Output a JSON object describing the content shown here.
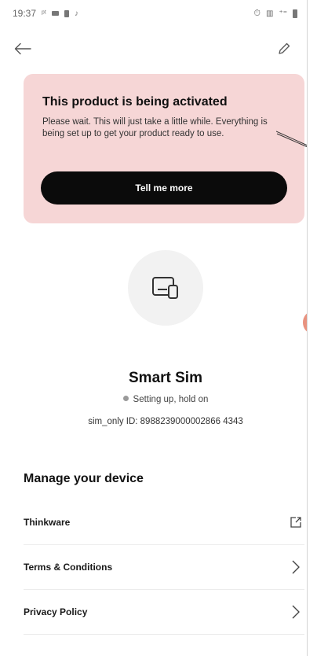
{
  "status_bar": {
    "time": "19:37"
  },
  "banner": {
    "title": "This product is being activated",
    "body": "Please wait. This will just take a little while. Everything is being set up to get your product ready to use.",
    "button_label": "Tell me more"
  },
  "device": {
    "name": "Smart Sim",
    "status": "Setting up, hold on",
    "id_text": "sim_only ID: 8988239000002866 4343"
  },
  "manage": {
    "title": "Manage your device",
    "items": [
      {
        "label": "Thinkware",
        "icon": "external-link-icon"
      },
      {
        "label": "Terms & Conditions",
        "icon": "chevron-right-icon"
      },
      {
        "label": "Privacy Policy",
        "icon": "chevron-right-icon"
      }
    ]
  },
  "colors": {
    "banner_bg": "#f6d6d6",
    "button_bg": "#0b0b0b",
    "accent_bubble": "#e8927f"
  }
}
